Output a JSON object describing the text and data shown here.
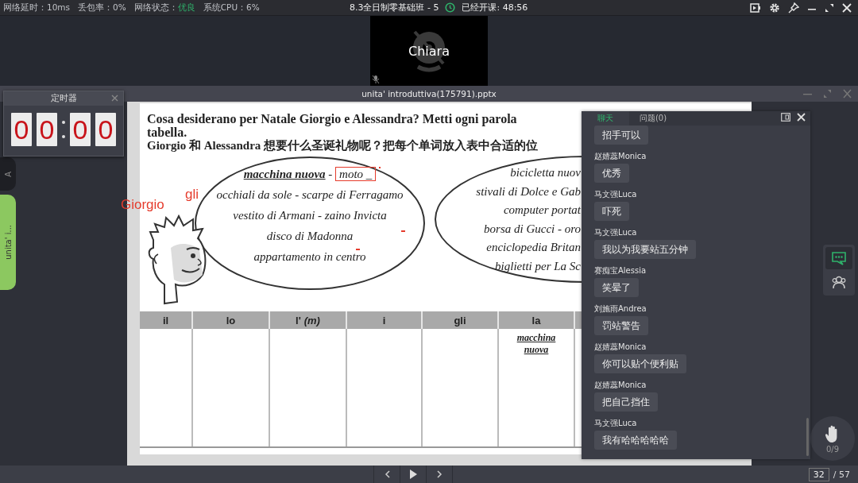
{
  "stats": [
    {
      "label": "网络延时：",
      "value": "10ms",
      "highlight": false
    },
    {
      "label": "丢包率：",
      "value": "0%",
      "highlight": false
    },
    {
      "label": "网络状态：",
      "value": "优良",
      "highlight": true
    },
    {
      "label": "系统CPU：",
      "value": "6%",
      "highlight": false
    }
  ],
  "class_title": "8.3全日制零基础班 - 5",
  "elapsed": "已经开课: 48:56",
  "video": {
    "name": "Chiara",
    "camera_off": true,
    "mic_muted": true
  },
  "document": {
    "title": "unita' introduttiva(175791).pptx",
    "tabs": [
      {
        "label": "A",
        "selected": false
      },
      {
        "label": "unita' i...",
        "selected": true
      }
    ]
  },
  "timer": {
    "title": "定时器",
    "digits": [
      "0",
      "0",
      "0",
      "0"
    ]
  },
  "slide": {
    "heading": [
      "Cosa desiderano per Natale Giorgio e Alessandra? Metti ogni parola",
      "tabella.",
      "Giorgio 和 Alessandra 想要什么圣诞礼物呢？把每个单词放入表中合适的位"
    ],
    "bubble_1": {
      "done_word": "macchina nuova",
      "separator": "-",
      "marked_word": "moto _",
      "lines": [
        "occhiali da sole - scarpe di Ferragamo",
        "vestito di Armani -  zaino Invicta",
        "disco di Madonna",
        "appartamento in centro"
      ]
    },
    "bubble_2": {
      "lines": [
        "bicicletta nuov",
        "stivali di Dolce e Gab",
        "computer portat",
        "borsa di Gucci - oro",
        "enciclopedia Britan",
        "biglietti per La Sc"
      ]
    },
    "annotations": [
      "Giorgio",
      "gli"
    ],
    "table": {
      "columns": [
        {
          "header": "il"
        },
        {
          "header": "lo"
        },
        {
          "header": "l'",
          "note": "(m)"
        },
        {
          "header": "i"
        },
        {
          "header": "gli"
        },
        {
          "header": "la",
          "entries": [
            "macchina nuova"
          ]
        }
      ]
    }
  },
  "chat": {
    "tabs": [
      {
        "label": "聊天",
        "selected": true
      },
      {
        "label": "问题(0)",
        "selected": false
      }
    ],
    "messages": [
      {
        "text": "招手可以"
      },
      {
        "sender": "赵婧蕊Monica",
        "text": "优秀"
      },
      {
        "sender": "马文强Luca",
        "text": "吓死"
      },
      {
        "sender": "马文强Luca",
        "text": "我以为我要站五分钟"
      },
      {
        "sender": "赛痴宝Alessia",
        "text": "笑晕了"
      },
      {
        "sender": "刘施雨Andrea",
        "text": "罚站警告"
      },
      {
        "sender": "赵婧蕊Monica",
        "text": "你可以贴个便利贴"
      },
      {
        "sender": "赵婧蕊Monica",
        "text": "把自己挡住"
      },
      {
        "sender": "马文强Luca",
        "text": "我有哈哈哈哈哈"
      }
    ]
  },
  "side_tools": [
    {
      "kind": "chat",
      "selected": true
    },
    {
      "kind": "members",
      "selected": false
    }
  ],
  "hand_raise": {
    "count": "0/9"
  },
  "pager": {
    "page": "32",
    "total": "/ 57"
  }
}
